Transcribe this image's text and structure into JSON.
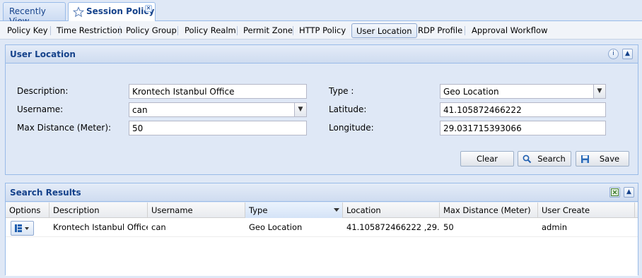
{
  "top_tabs": {
    "recently_view": "Recently View",
    "session_policy": "Session Policy"
  },
  "sub_tabs": [
    "Policy Key",
    "Time Restriction",
    "Policy Group",
    "Policy Realm",
    "Permit Zone",
    "HTTP Policy",
    "User Location",
    "RDP Profile",
    "Approval Workflow"
  ],
  "user_location": {
    "title": "User Location",
    "description_label": "Description:",
    "description_value": "Krontech Istanbul Office",
    "username_label": "Username:",
    "username_value": "can",
    "max_distance_label": "Max Distance (Meter):",
    "max_distance_value": "50",
    "type_label": "Type :",
    "type_value": "Geo Location",
    "latitude_label": "Latitude:",
    "latitude_value": "41.105872466222",
    "longitude_label": "Longitude:",
    "longitude_value": "29.031715393066",
    "clear_label": "Clear",
    "search_label": "Search",
    "save_label": "Save"
  },
  "search_results": {
    "title": "Search Results",
    "columns": [
      "Options",
      "Description",
      "Username",
      "Type",
      "Location",
      "Max Distance (Meter)",
      "User Create"
    ],
    "rows": [
      {
        "description": "Krontech Istanbul Office",
        "username": "can",
        "type": "Geo Location",
        "location": "41.105872466222 ,29....",
        "max_distance": "50",
        "user_create": "admin"
      }
    ]
  },
  "colors": {
    "accent": "#15428b",
    "panel_bg": "#dfe8f6",
    "border": "#99bbe8"
  }
}
